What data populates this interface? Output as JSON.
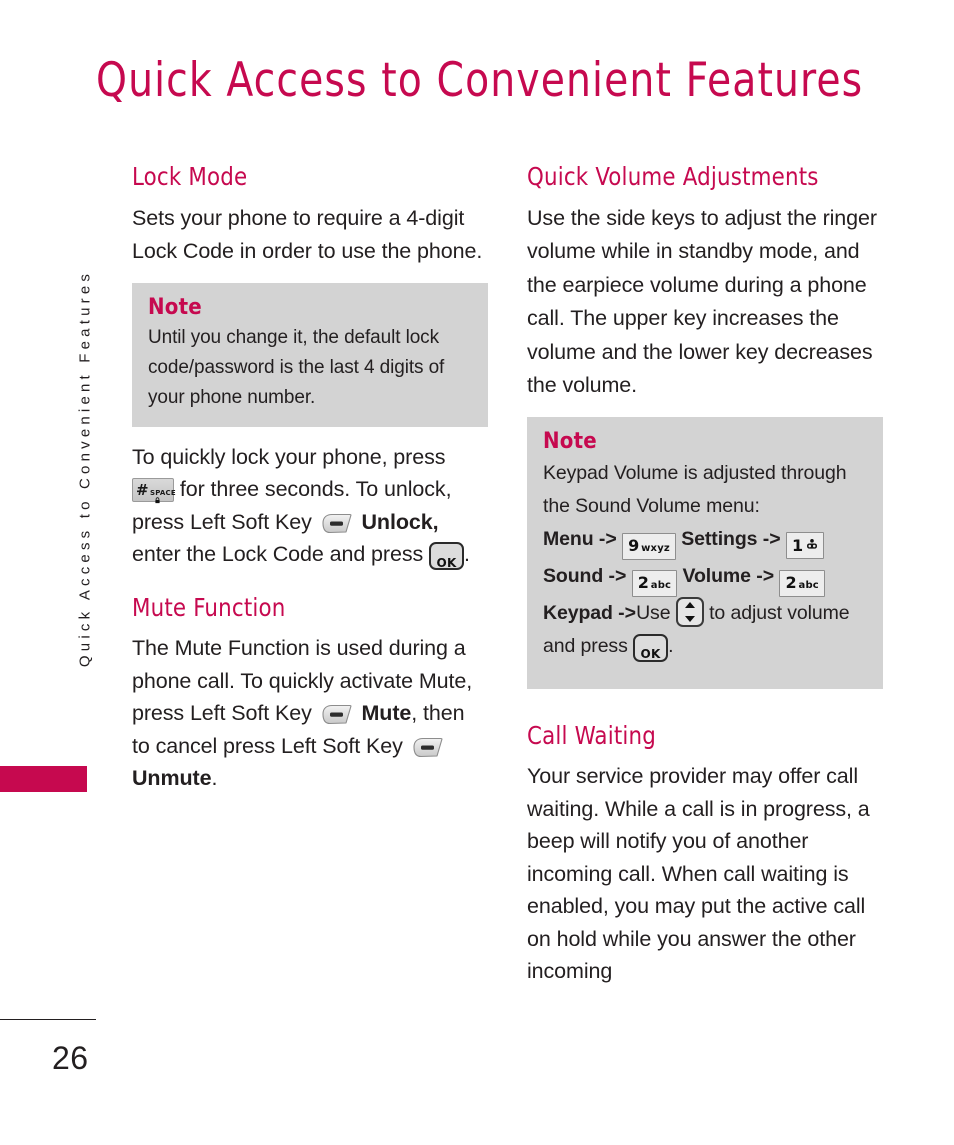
{
  "page": {
    "title": "Quick Access to Convenient Features",
    "running_head": "Quick Access to Convenient Features",
    "folio": "26",
    "accent_color": "#c6094f",
    "note_background": "#d3d3d3",
    "text_color": "#231f20"
  },
  "left_column": {
    "lock_mode": {
      "heading": "Lock Mode",
      "body": "Sets your phone to require a 4-digit Lock Code in order to use the phone.",
      "note": {
        "title": "Note",
        "body": "Until you change it, the default lock code/password is the last 4 digits of your phone number."
      },
      "instructions": {
        "part1": "To quickly lock your phone, press",
        "key_hash": {
          "digit": "#",
          "label": "SPACE",
          "icon": "lock-icon"
        },
        "part2": "for three seconds. To unlock, press Left Soft Key",
        "key_soft": "left-soft-key-icon",
        "bold1": "Unlock,",
        "part3": "enter the Lock Code and press",
        "key_ok": "OK",
        "part4": "."
      }
    },
    "mute_function": {
      "heading": "Mute Function",
      "part1": "The Mute Function is used during a phone call. To quickly activate Mute, press Left Soft Key",
      "key_soft_1": "left-soft-key-icon",
      "bold1": "Mute",
      "part2": ", then to cancel press Left Soft Key",
      "key_soft_2": "left-soft-key-icon",
      "bold2": "Unmute",
      "part3": "."
    }
  },
  "right_column": {
    "quick_volume": {
      "heading": "Quick Volume Adjustments",
      "body": "Use the side keys to adjust the ringer volume while in standby mode, and the earpiece volume during a phone call. The upper key increases the volume and the lower key decreases the volume.",
      "note": {
        "title": "Note",
        "line1": "Keypad Volume is adjusted through the Sound Volume menu:",
        "steps": {
          "menu": "Menu",
          "arrow1": "->",
          "key9": {
            "digit": "9",
            "letters": "wxyz"
          },
          "settings": "Settings",
          "arrow2": "->",
          "key1": {
            "digit": "1",
            "icon": "voicemail-icon"
          },
          "sound": "Sound",
          "arrow3": "->",
          "key2a": {
            "digit": "2",
            "letters": "abc"
          },
          "volume": "Volume",
          "arrow4": "->",
          "key2b": {
            "digit": "2",
            "letters": "abc"
          },
          "keypad": "Keypad",
          "arrow5": "->",
          "use": "Use",
          "key_updown": "up-down-nav-key-icon",
          "to_adjust": "to adjust volume and press",
          "key_ok": "OK",
          "period": "."
        }
      }
    },
    "call_waiting": {
      "heading": "Call Waiting",
      "body": "Your service provider may offer call waiting. While a call is in progress, a beep will notify you of another incoming call. When call waiting is enabled, you may put the active call on hold while you answer the other incoming"
    }
  }
}
